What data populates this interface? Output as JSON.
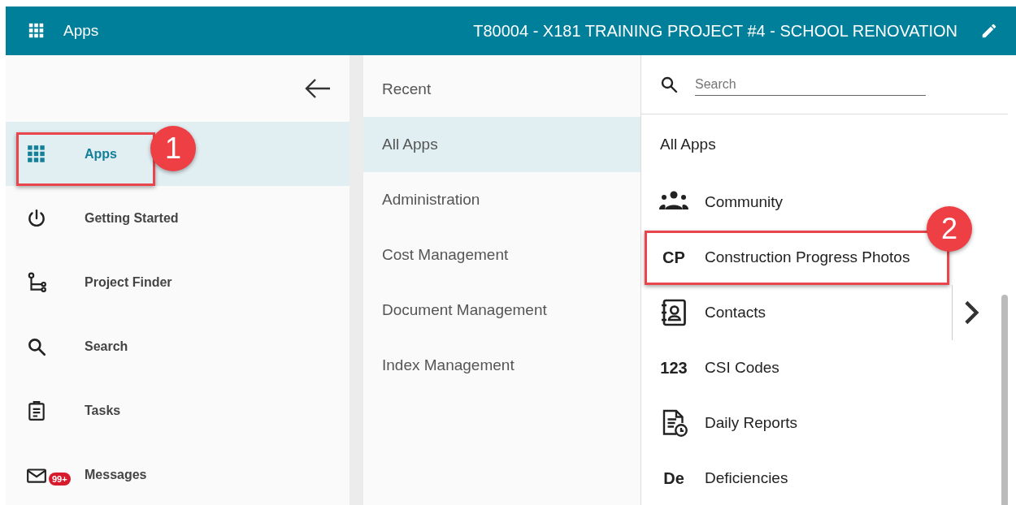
{
  "header": {
    "menu_label": "Apps",
    "project_title": "T80004 - X181 TRAINING PROJECT #4 - SCHOOL RENOVATION"
  },
  "nav": {
    "items": [
      {
        "label": "Apps",
        "selected": true,
        "callout": "1"
      },
      {
        "label": "Getting Started",
        "selected": false
      },
      {
        "label": "Project Finder",
        "selected": false
      },
      {
        "label": "Search",
        "selected": false
      },
      {
        "label": "Tasks",
        "selected": false
      },
      {
        "label": "Messages",
        "selected": false,
        "badge": "99+"
      }
    ]
  },
  "categories": [
    {
      "label": "Recent",
      "selected": false
    },
    {
      "label": "All Apps",
      "selected": true
    },
    {
      "label": "Administration",
      "selected": false
    },
    {
      "label": "Cost Management",
      "selected": false
    },
    {
      "label": "Document Management",
      "selected": false
    },
    {
      "label": "Index Management",
      "selected": false
    }
  ],
  "apps": {
    "search_placeholder": "Search",
    "heading": "All Apps",
    "items": [
      {
        "kind": "icon",
        "label": "Community"
      },
      {
        "kind": "abbr",
        "abbr": "CP",
        "label": "Construction Progress Photos",
        "callout": "2"
      },
      {
        "kind": "icon",
        "label": "Contacts",
        "expandable": true
      },
      {
        "kind": "abbr",
        "abbr": "123",
        "label": "CSI Codes"
      },
      {
        "kind": "icon",
        "label": "Daily Reports"
      },
      {
        "kind": "abbr",
        "abbr": "De",
        "label": "Deficiencies"
      }
    ]
  }
}
